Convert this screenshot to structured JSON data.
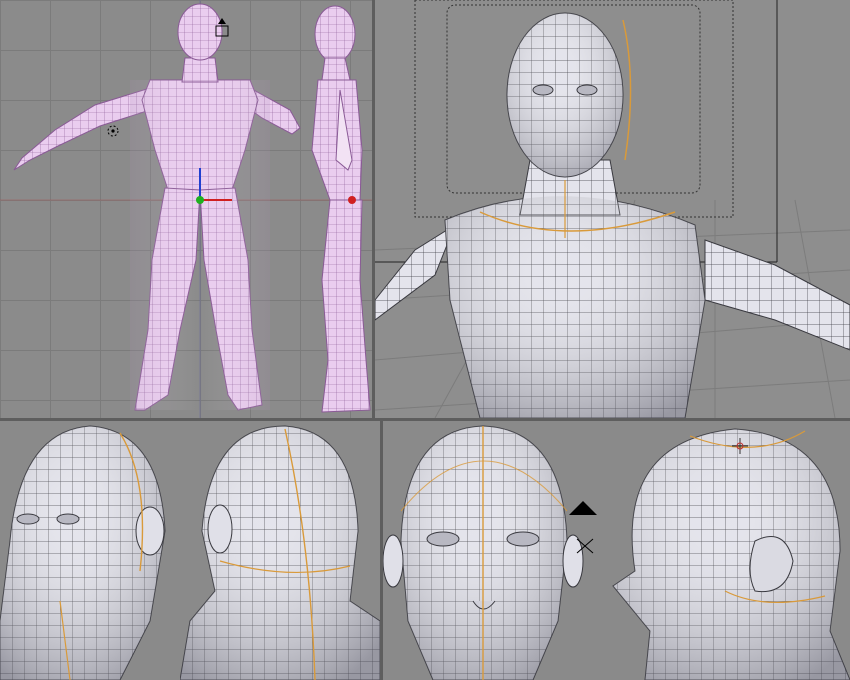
{
  "app": {
    "viewports": [
      {
        "name": "front-and-side-ortho",
        "mesh_color": "#e8c8ee",
        "wire_color": "#8a5a96"
      },
      {
        "name": "perspective-torso",
        "mesh_color": "#e7e7ee",
        "wire_color": "#3a3a40"
      },
      {
        "name": "head-three-quarter",
        "mesh_color": "#e7e7ee"
      },
      {
        "name": "head-back",
        "mesh_color": "#e7e7ee"
      },
      {
        "name": "head-front",
        "mesh_color": "#e7e7ee"
      },
      {
        "name": "head-profile",
        "mesh_color": "#e7e7ee"
      }
    ],
    "seam_color": "#d99a3a",
    "grid_color": "#7b7b7b",
    "viewport_bg": "#8b8b8b",
    "icons": [
      "camera-icon",
      "3d-cursor-icon",
      "lamp-icon",
      "manipulator-icon"
    ]
  }
}
